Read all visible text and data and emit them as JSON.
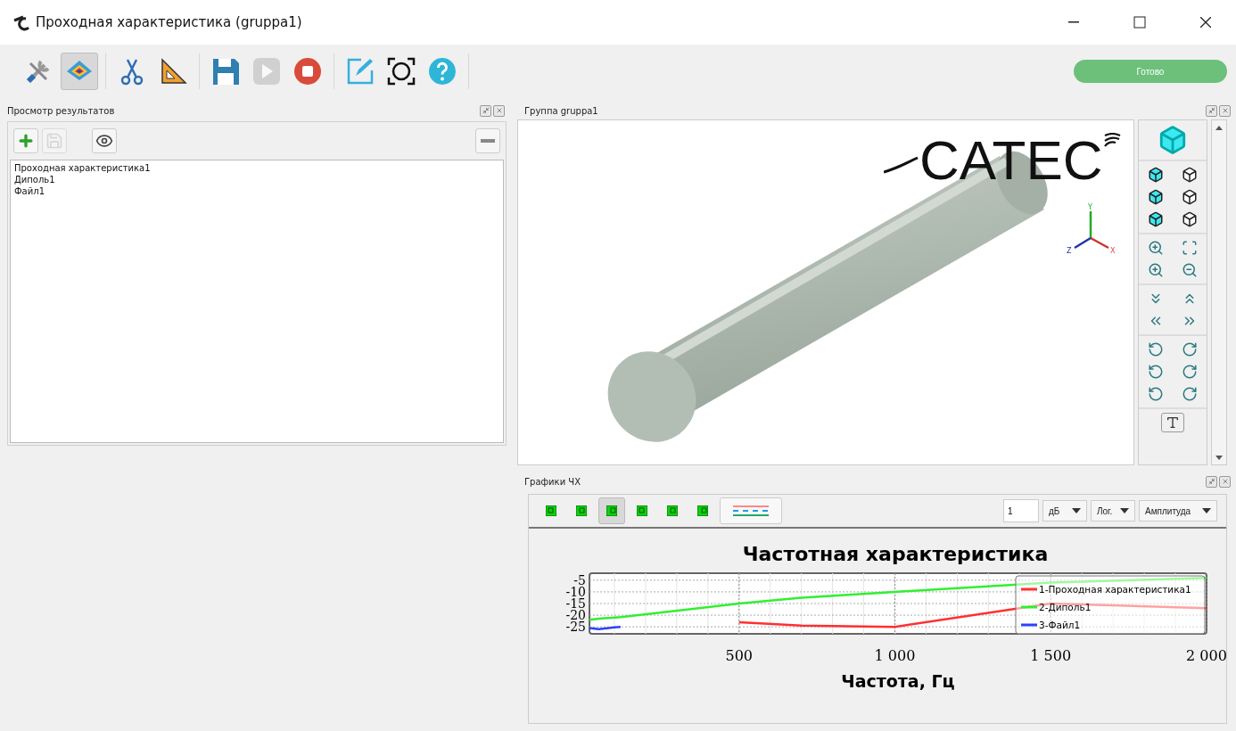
{
  "window": {
    "title": "Проходная характеристика (gruppa1)"
  },
  "toolbar": {
    "buttons": [
      {
        "kind": "tools",
        "selected": false,
        "disabled": false
      },
      {
        "kind": "surface",
        "selected": true,
        "disabled": false
      },
      {
        "kind": "scissors",
        "selected": false,
        "disabled": false
      },
      {
        "kind": "ruler",
        "selected": false,
        "disabled": false
      },
      {
        "kind": "save",
        "selected": false,
        "disabled": false
      },
      {
        "kind": "play",
        "selected": false,
        "disabled": true
      },
      {
        "kind": "stop",
        "selected": false,
        "disabled": false
      },
      {
        "kind": "edit",
        "selected": false,
        "disabled": false
      },
      {
        "kind": "target",
        "selected": false,
        "disabled": false
      },
      {
        "kind": "help",
        "selected": false,
        "disabled": false
      }
    ],
    "status": "Готово"
  },
  "results_panel": {
    "title": "Просмотр результатов",
    "buttons": [
      {
        "kind": "add",
        "disabled": false
      },
      {
        "kind": "save",
        "disabled": true
      },
      {
        "kind": "view",
        "disabled": false
      },
      {
        "kind": "remove",
        "disabled": false
      }
    ],
    "items": [
      "Проходная характеристика1",
      "Диполь1",
      "Файл1"
    ]
  },
  "viewport_panel": {
    "title": "Группа gruppa1",
    "logo": "CATEC",
    "axes": [
      "Y",
      "Z",
      "X"
    ]
  },
  "chart_panel": {
    "title": "Графики ЧХ",
    "tools": [
      {
        "selected": false
      },
      {
        "selected": false
      },
      {
        "selected": true
      },
      {
        "selected": false
      },
      {
        "selected": false
      },
      {
        "selected": false
      }
    ],
    "scale_field": {
      "value": "1"
    },
    "dropdowns": [
      "дБ",
      "Лог.",
      "Амплитуда"
    ],
    "chart_data": {
      "type": "line",
      "title": "Частотная характеристика",
      "xlabel": "Частота, Гц",
      "x": [
        20,
        50,
        100,
        120,
        500,
        700,
        1000,
        1500,
        2000
      ],
      "series": [
        {
          "name": "1-Проходная характеристика1",
          "color": "#ff3030",
          "values": [
            null,
            null,
            null,
            null,
            -23,
            -24.5,
            -25,
            -15,
            -17
          ]
        },
        {
          "name": "2-Диполь1",
          "color": "#30f030",
          "values": [
            -22,
            -21.5,
            -21,
            -20.8,
            -15,
            -12.5,
            -10,
            -6,
            -4
          ]
        },
        {
          "name": "3-Файл1",
          "color": "#3040ff",
          "values": [
            -25.5,
            -26,
            -25.2,
            -25,
            null,
            null,
            null,
            null,
            null
          ]
        }
      ],
      "xlim": [
        20,
        2000
      ],
      "ylim": [
        -28,
        -2
      ],
      "xticks": [
        {
          "value": 500,
          "label": "500"
        },
        {
          "value": 1000,
          "label": "1 000"
        },
        {
          "value": 1500,
          "label": "1 500"
        },
        {
          "value": 2000,
          "label": "2 000"
        }
      ],
      "yticks": [
        -5,
        -10,
        -15,
        -20,
        -25
      ],
      "grid": true,
      "legend": true
    }
  }
}
